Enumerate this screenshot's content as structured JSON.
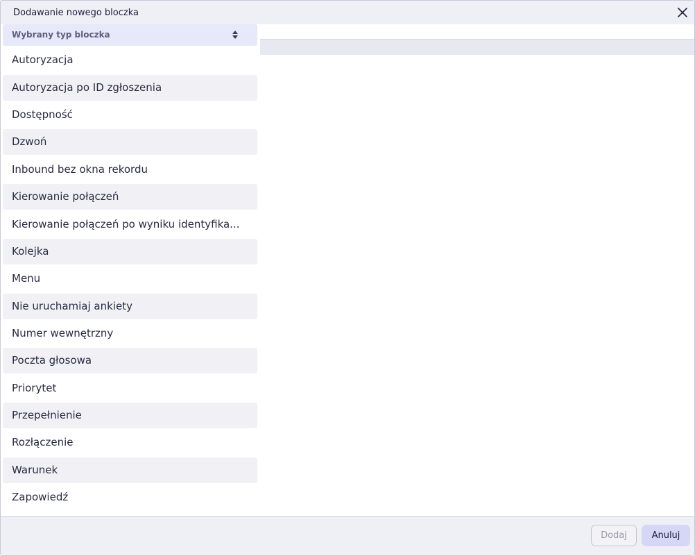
{
  "dialog": {
    "title": "Dodawanie nowego bloczka"
  },
  "dropdown": {
    "header_label": "Wybrany typ bloczka",
    "items": [
      {
        "label": "Autoryzacja"
      },
      {
        "label": "Autoryzacja po ID zgłoszenia"
      },
      {
        "label": "Dostępność"
      },
      {
        "label": "Dzwoń"
      },
      {
        "label": "Inbound bez okna rekordu"
      },
      {
        "label": "Kierowanie połączeń"
      },
      {
        "label": "Kierowanie połączeń po wyniku identyfika..."
      },
      {
        "label": "Kolejka"
      },
      {
        "label": "Menu"
      },
      {
        "label": "Nie uruchamiaj ankiety"
      },
      {
        "label": "Numer wewnętrzny"
      },
      {
        "label": "Poczta głosowa"
      },
      {
        "label": "Priorytet"
      },
      {
        "label": "Przepełnienie"
      },
      {
        "label": "Rozłączenie"
      },
      {
        "label": "Warunek"
      },
      {
        "label": "Zapowiedź"
      }
    ]
  },
  "footer": {
    "add_label": "Dodaj",
    "cancel_label": "Anuluj"
  },
  "icons": {
    "close": "close-icon",
    "sort": "sort-icon"
  },
  "colors": {
    "titlebar_bg": "#efeff6",
    "dropdown_header_bg": "#e8e8fb",
    "item_alt_bg": "#f1f1f5",
    "cancel_bg": "#d6d6f6"
  }
}
